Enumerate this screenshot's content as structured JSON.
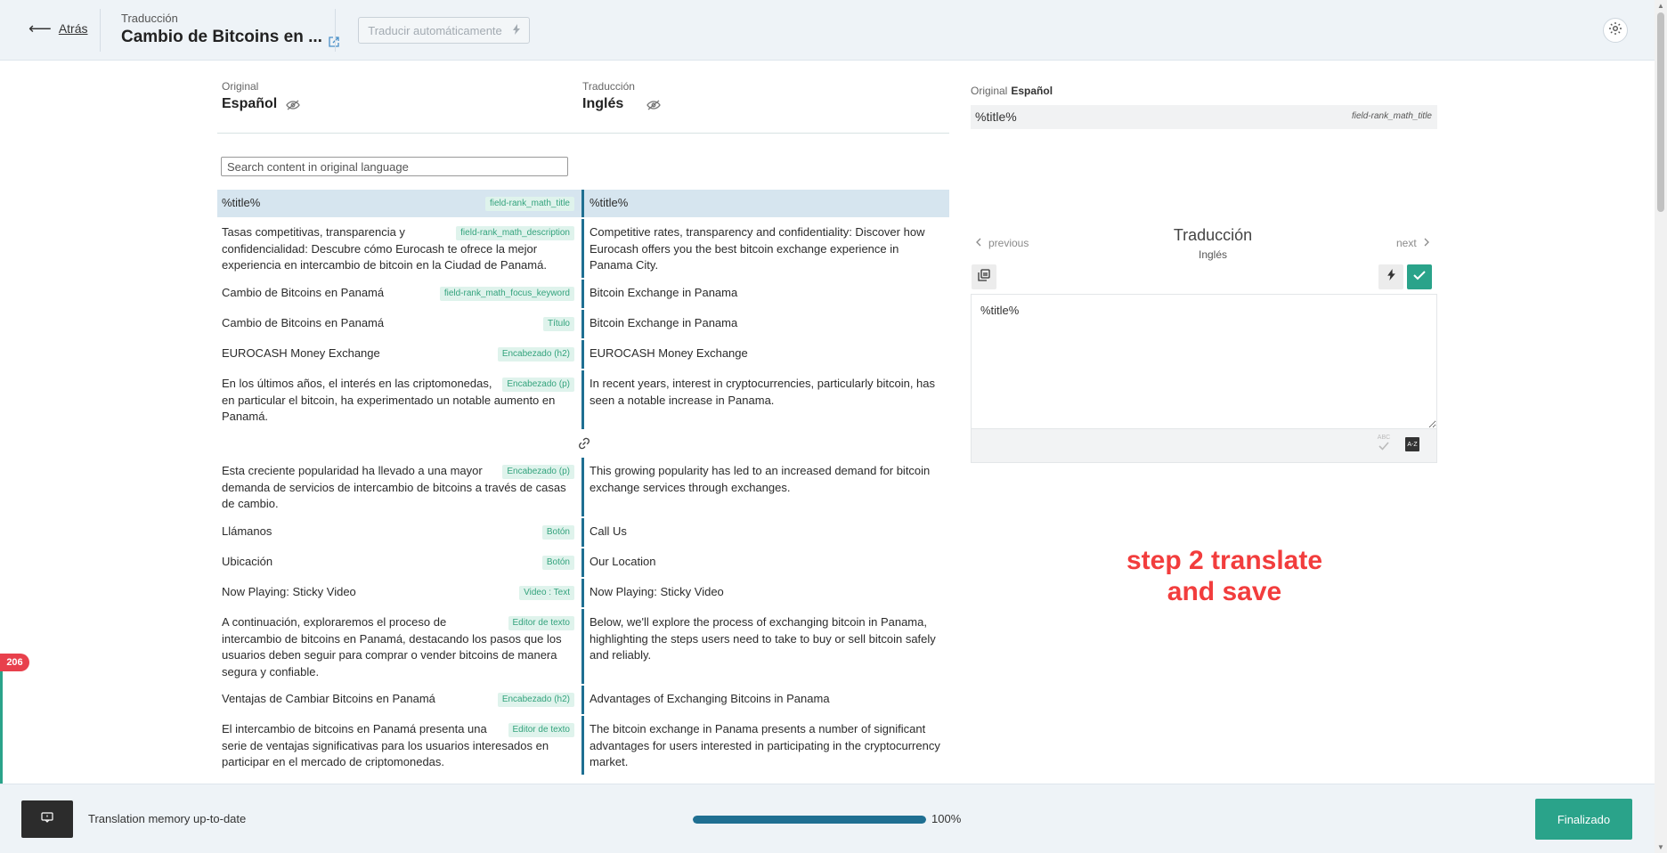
{
  "header": {
    "back_label": "Atrás",
    "subtitle": "Traducción",
    "title": "Cambio de Bitcoins en ...",
    "auto_translate_label": "Traducir automáticamente"
  },
  "columns": {
    "original_caption": "Original",
    "original_lang": "Español",
    "translation_caption": "Traducción",
    "translation_lang": "Inglés"
  },
  "search": {
    "placeholder": "Search content in original language"
  },
  "rows": [
    {
      "original": "%title%",
      "tag": "field-rank_math_title",
      "translation": "%title%"
    },
    {
      "original": "Tasas competitivas, transparencia y confidencialidad: Descubre cómo Eurocash te ofrece la mejor experiencia en intercambio de bitcoin en la Ciudad de Panamá.",
      "tag": "field-rank_math_description",
      "translation": "Competitive rates, transparency and confidentiality: Discover how Eurocash offers you the best bitcoin exchange experience in Panama City."
    },
    {
      "original": "Cambio de Bitcoins en Panamá",
      "tag": "field-rank_math_focus_keyword",
      "translation": "Bitcoin Exchange in Panama"
    },
    {
      "original": "Cambio de Bitcoins en Panamá",
      "tag": "Título",
      "translation": "Bitcoin Exchange in Panama"
    },
    {
      "original": "EUROCASH Money Exchange",
      "tag": "Encabezado (h2)",
      "translation": "EUROCASH Money Exchange"
    },
    {
      "original": "En los últimos años, el interés en las criptomonedas, en particular el bitcoin, ha experimentado un notable aumento en Panamá.",
      "tag": "Encabezado (p)",
      "translation": "In recent years, interest in cryptocurrencies, particularly bitcoin, has seen a notable increase in Panama."
    },
    {
      "original": "Esta creciente popularidad ha llevado a una mayor demanda de servicios de intercambio de bitcoins a través de casas de cambio.",
      "tag": "Encabezado (p)",
      "translation": "This growing popularity has led to an increased demand for bitcoin exchange services through exchanges."
    },
    {
      "original": "Llámanos",
      "tag": "Botón",
      "translation": "Call Us"
    },
    {
      "original": "Ubicación",
      "tag": "Botón",
      "translation": "Our Location"
    },
    {
      "original": "Now Playing: Sticky Video",
      "tag": "Video : Text",
      "translation": "Now Playing: Sticky Video"
    },
    {
      "original": "A continuación, exploraremos el proceso de intercambio de bitcoins en Panamá, destacando los pasos que los usuarios deben seguir para comprar o vender bitcoins de manera segura y confiable.",
      "tag": "Editor de texto",
      "translation": "Below, we'll explore the process of exchanging bitcoin in Panama, highlighting the steps users need to take to buy or sell bitcoin safely and reliably."
    },
    {
      "original": "Ventajas de Cambiar Bitcoins en Panamá",
      "tag": "Encabezado (h2)",
      "translation": "Advantages of Exchanging Bitcoins in Panama"
    },
    {
      "original": "El intercambio de bitcoins en Panamá presenta una serie de ventajas significativas para los usuarios interesados en participar en el mercado de criptomonedas.",
      "tag": "Editor de texto",
      "translation": "The bitcoin exchange in Panama presents a number of significant advantages for users interested in participating in the cryptocurrency market."
    }
  ],
  "panel": {
    "original_caption": "Original",
    "original_lang": "Español",
    "original_text": "%title%",
    "field_tag": "field-rank_math_title",
    "prev_label": "previous",
    "next_label": "next",
    "title": "Traducción",
    "lang": "Inglés",
    "editor_value": "%title%",
    "spell_label": "ABC",
    "dict_label": "A-Z"
  },
  "annotation": {
    "line1": "step 2 translate",
    "line2": "and save"
  },
  "footer": {
    "tm_status": "Translation memory up-to-date",
    "progress": 100,
    "progress_label": "100%",
    "done_label": "Finalizado"
  },
  "badge": {
    "count": "206"
  }
}
